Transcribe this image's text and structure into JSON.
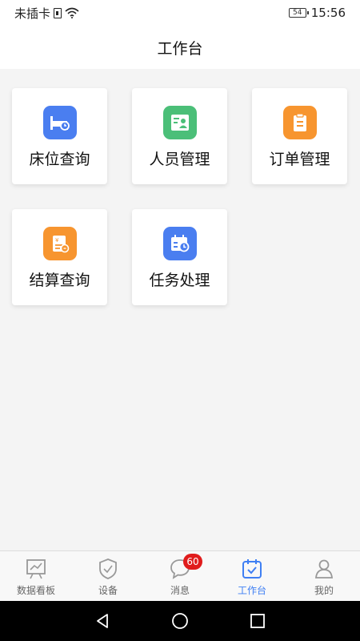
{
  "status_bar": {
    "carrier": "未插卡",
    "battery_level": "54",
    "battery_fraction": 0.54,
    "time": "15:56"
  },
  "header": {
    "title": "工作台"
  },
  "cards": [
    {
      "label": "床位查询",
      "icon": "bed-icon",
      "color": "#4a7ef0"
    },
    {
      "label": "人员管理",
      "icon": "person-card-icon",
      "color": "#4bbf78"
    },
    {
      "label": "订单管理",
      "icon": "clipboard-icon",
      "color": "#f7952f"
    },
    {
      "label": "结算查询",
      "icon": "bill-icon",
      "color": "#f7952f"
    },
    {
      "label": "任务处理",
      "icon": "calendar-clock-icon",
      "color": "#4a7ef0"
    }
  ],
  "bottom_nav": {
    "items": [
      {
        "label": "数据看板",
        "icon": "chart-board-icon"
      },
      {
        "label": "设备",
        "icon": "shield-check-icon"
      },
      {
        "label": "消息",
        "icon": "chat-bubble-icon",
        "badge": "60"
      },
      {
        "label": "工作台",
        "icon": "calendar-check-icon",
        "active": true
      },
      {
        "label": "我的",
        "icon": "user-icon"
      }
    ],
    "active_color": "#3f7ff3",
    "inactive_color": "#999999"
  },
  "system_nav": {
    "icons": [
      "back-icon",
      "home-icon",
      "recents-icon"
    ]
  }
}
